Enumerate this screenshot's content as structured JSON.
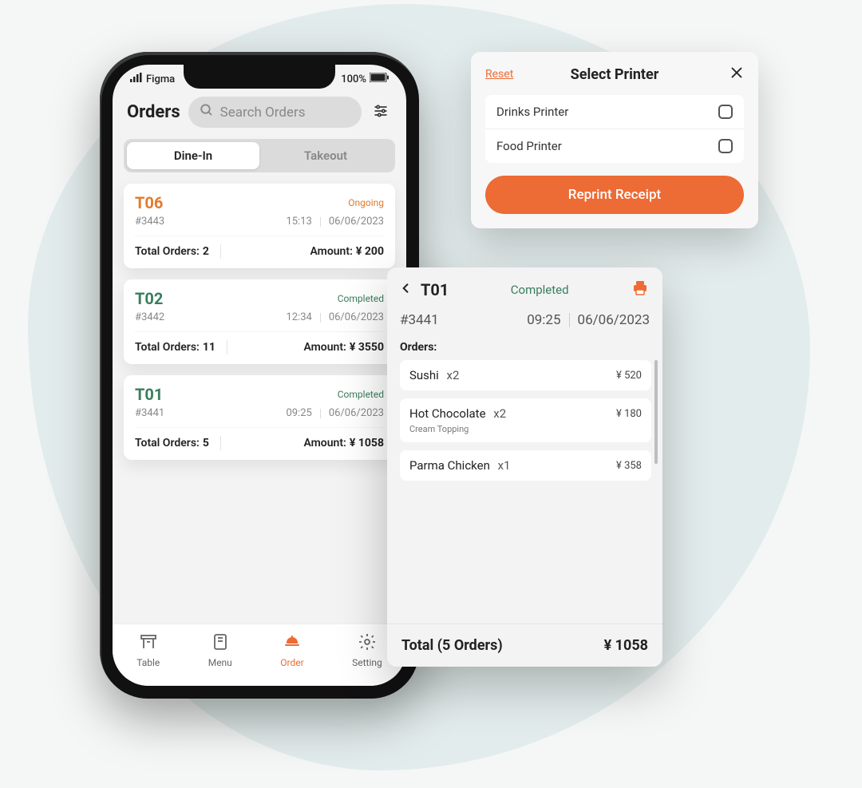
{
  "status": {
    "carrier": "Figma",
    "battery": "100%"
  },
  "header": {
    "title": "Orders",
    "search_placeholder": "Search Orders"
  },
  "seg": {
    "dine_in": "Dine-In",
    "takeout": "Takeout"
  },
  "labels": {
    "total_orders": "Total Orders:",
    "amount": "Amount:",
    "orders": "Orders:"
  },
  "orders": [
    {
      "table": "T06",
      "status": "Ongoing",
      "status_kind": "orange",
      "id": "#3443",
      "time": "15:13",
      "date": "06/06/2023",
      "count": "2",
      "amount": "¥ 200"
    },
    {
      "table": "T02",
      "status": "Completed",
      "status_kind": "green",
      "id": "#3442",
      "time": "12:34",
      "date": "06/06/2023",
      "count": "11",
      "amount": "¥ 3550"
    },
    {
      "table": "T01",
      "status": "Completed",
      "status_kind": "green",
      "id": "#3441",
      "time": "09:25",
      "date": "06/06/2023",
      "count": "5",
      "amount": "¥ 1058"
    }
  ],
  "tabs": {
    "table": "Table",
    "menu": "Menu",
    "order": "Order",
    "setting": "Setting"
  },
  "printer": {
    "reset": "Reset",
    "title": "Select Printer",
    "options": [
      "Drinks Printer",
      "Food Printer"
    ],
    "button": "Reprint Receipt"
  },
  "detail": {
    "table": "T01",
    "status": "Completed",
    "id": "#3441",
    "time": "09:25",
    "date": "06/06/2023",
    "items": [
      {
        "name": "Sushi",
        "qty": "x2",
        "price": "¥ 520",
        "sub": ""
      },
      {
        "name": "Hot Chocolate",
        "qty": "x2",
        "price": "¥ 180",
        "sub": "Cream Topping"
      },
      {
        "name": "Parma Chicken",
        "qty": "x1",
        "price": "¥ 358",
        "sub": ""
      }
    ],
    "total_label": "Total  (5 Orders)",
    "total_value": "¥ 1058"
  }
}
